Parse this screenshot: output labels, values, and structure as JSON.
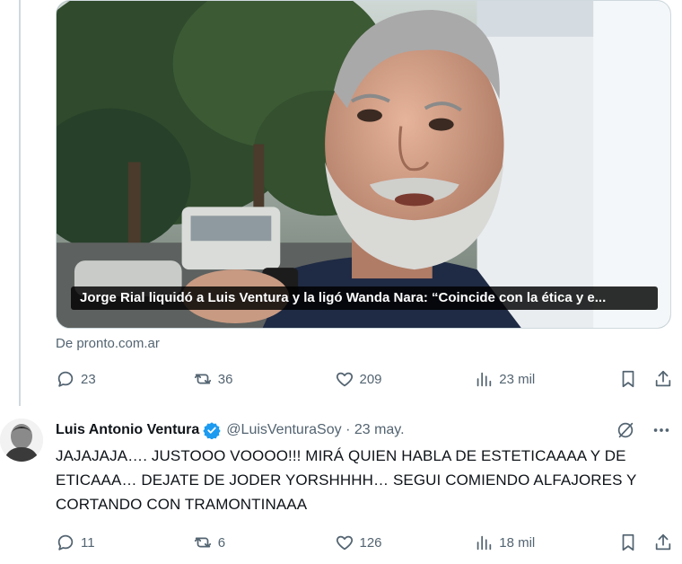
{
  "previous_tweet": {
    "media_caption": "Jorge Rial liquidó a Luis Ventura y la ligó Wanda Nara: “Coincide con la ética y e...",
    "source": "De pronto.com.ar",
    "actions": {
      "replies": "23",
      "reposts": "36",
      "likes": "209",
      "views": "23 mil"
    }
  },
  "tweet": {
    "author_name": "Luis Antonio Ventura",
    "handle_date": "@LuisVenturaSoy · 23 may.",
    "text": "JAJAJAJA…. JUSTOOO VOOOO!!! MIRÁ QUIEN HABLA DE ESTETICAAAA Y DE ETICAAA… DEJATE DE JODER YORSHHHH… SEGUI COMIENDO ALFAJORES Y CORTANDO CON TRAMONTINAAA",
    "actions": {
      "replies": "11",
      "reposts": "6",
      "likes": "126",
      "views": "18 mil"
    }
  },
  "colors": {
    "text_primary": "#0f1419",
    "text_secondary": "#536471",
    "verified": "#1d9bf0",
    "border": "#cfd9de"
  },
  "icons": [
    "reply-icon",
    "repost-icon",
    "like-icon",
    "views-icon",
    "bookmark-icon",
    "share-icon",
    "verified-icon",
    "grok-icon",
    "more-icon"
  ]
}
